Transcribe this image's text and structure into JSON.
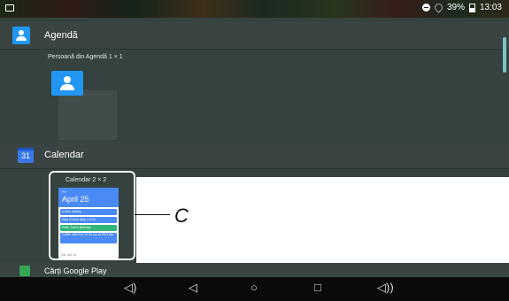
{
  "status_bar": {
    "battery_text": "39%",
    "time": "13:03"
  },
  "sections": [
    {
      "app_name": "Agendă",
      "widget_label": "Persoană din Agendă  1 × 1"
    },
    {
      "app_name": "Calendar",
      "app_icon_text": "31",
      "widget_label": "Calendar  2 × 2",
      "widget_preview": {
        "day": "Fri",
        "date": "April 25",
        "events": [
          {
            "text": "4 New visiting",
            "color": "#4a8af4"
          },
          {
            "text": "Stay in town (day 4 of 5)",
            "color": "#4a8af4"
          },
          {
            "text": "Peter Tran's Birthday",
            "color": "#33b679"
          },
          {
            "text": "Coffee with Eric 10:00 am at WOI Bar",
            "color": "#4a8af4"
          }
        ],
        "footer": "Sat, Apr 26"
      }
    }
  ],
  "next_section": {
    "app_name": "Cărți Google Play"
  },
  "annotation": {
    "letter": "C"
  },
  "nav_bar": {
    "buttons": [
      "volume-down",
      "back",
      "home",
      "recents",
      "volume-up"
    ]
  }
}
